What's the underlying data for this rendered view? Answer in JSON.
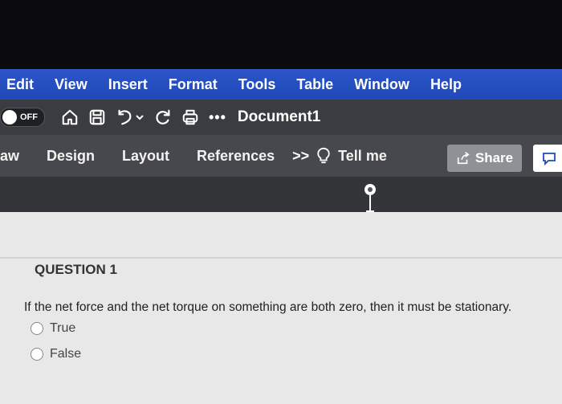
{
  "menubar": {
    "items": [
      "Edit",
      "View",
      "Insert",
      "Format",
      "Tools",
      "Table",
      "Window",
      "Help"
    ]
  },
  "toolbar": {
    "autosave_label": "OFF",
    "more_label": "•••",
    "document_title": "Document1",
    "icons": [
      "home-icon",
      "save-icon",
      "undo-icon",
      "chevron-down-icon",
      "redo-icon",
      "print-icon"
    ]
  },
  "ribbon": {
    "tabs": [
      "aw",
      "Design",
      "Layout",
      "References"
    ],
    "overflow_label": ">>",
    "tell_me": "Tell me",
    "share_label": "Share"
  },
  "quiz": {
    "question_title": "QUESTION 1",
    "question_text": "If the net force and the net torque on something are both zero, then it must be stationary.",
    "options": [
      "True",
      "False"
    ]
  },
  "colors": {
    "menubar_blue": "#2049b8",
    "toolbar_gray": "#3a3c41",
    "ribbon_gray": "#46484d",
    "page_bg": "#e9e8e8"
  }
}
